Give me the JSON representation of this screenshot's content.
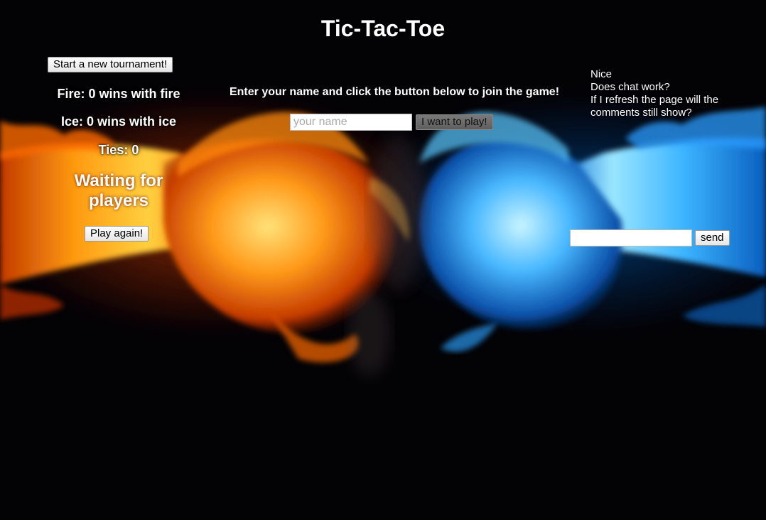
{
  "page": {
    "title": "Tic-Tac-Toe"
  },
  "sidebar": {
    "tournament_button": "Start a new tournament!",
    "fire_score": "Fire: 0 wins with fire",
    "ice_score": "Ice: 0 wins with ice",
    "ties": "Ties: 0",
    "status_line1": "Waiting for",
    "status_line2": "players",
    "play_again_button": "Play again!"
  },
  "join": {
    "instructions": "Enter your name and click the button below to join the game!",
    "name_placeholder": "your name",
    "play_button": "I want to play!"
  },
  "chat": {
    "messages": [
      "Nice",
      "Does chat work?",
      "If I refresh the page will the",
      "comments still show?"
    ],
    "send_button": "send"
  },
  "theme": {
    "background": "#030205",
    "fire_color": "#ff6a00",
    "ice_color": "#3cb4ff"
  }
}
